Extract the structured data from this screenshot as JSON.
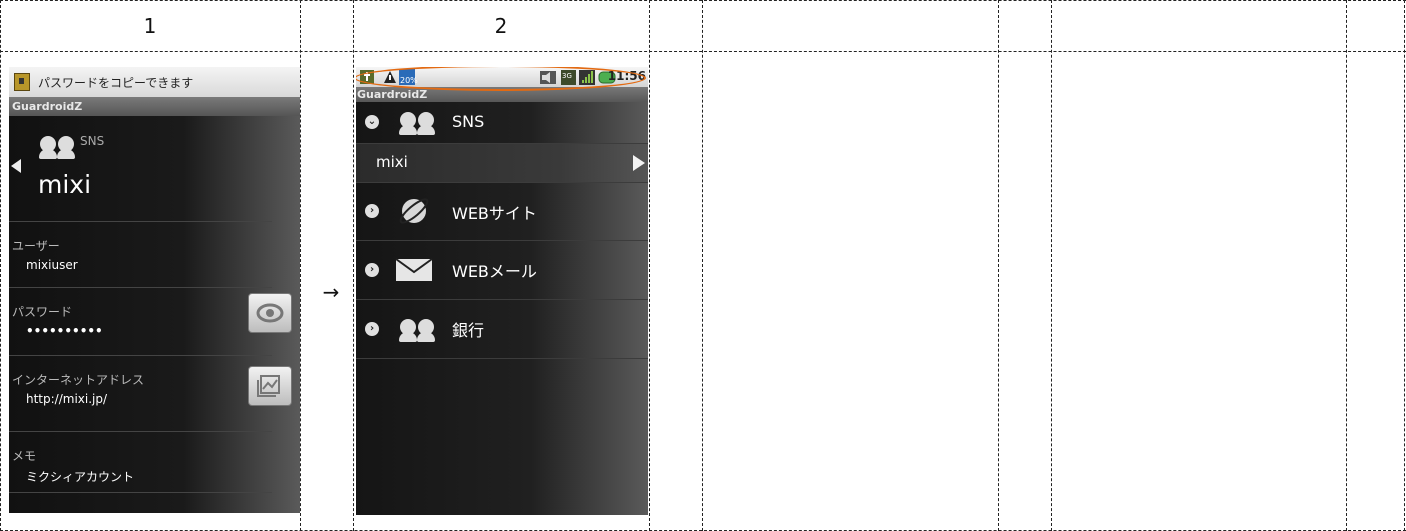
{
  "columns": {
    "col1_header": "1",
    "col2_header": "2",
    "arrow": "→"
  },
  "screen1": {
    "notification": "パスワードをコピーできます",
    "app_title": "GuardroidZ",
    "category": "SNS",
    "account": "mixi",
    "fields": [
      {
        "label": "ユーザー",
        "value": "mixiuser"
      },
      {
        "label": "パスワード",
        "value": "••••••••••"
      },
      {
        "label": "インターネットアドレス",
        "value": "http://mixi.jp/"
      },
      {
        "label": "メモ",
        "value": "ミクシィアカウント"
      }
    ],
    "icons": {
      "notification": "lock-notification-icon",
      "back": "back-arrow-icon",
      "category": "people-icon",
      "show_password": "eye-icon",
      "open_url": "browser-icon"
    }
  },
  "screen2": {
    "status_time": "11:56",
    "status_battery_text": "20%",
    "app_title": "GuardroidZ",
    "categories": [
      {
        "label": "SNS",
        "icon": "people-icon",
        "expanded": true
      },
      {
        "label": "WEBサイト",
        "icon": "globe-icon",
        "expanded": false
      },
      {
        "label": "WEBメール",
        "icon": "envelope-icon",
        "expanded": false
      },
      {
        "label": "銀行",
        "icon": "people-icon",
        "expanded": false
      }
    ],
    "sns_items": [
      "mixi"
    ],
    "highlight_color": "#e36a12"
  }
}
